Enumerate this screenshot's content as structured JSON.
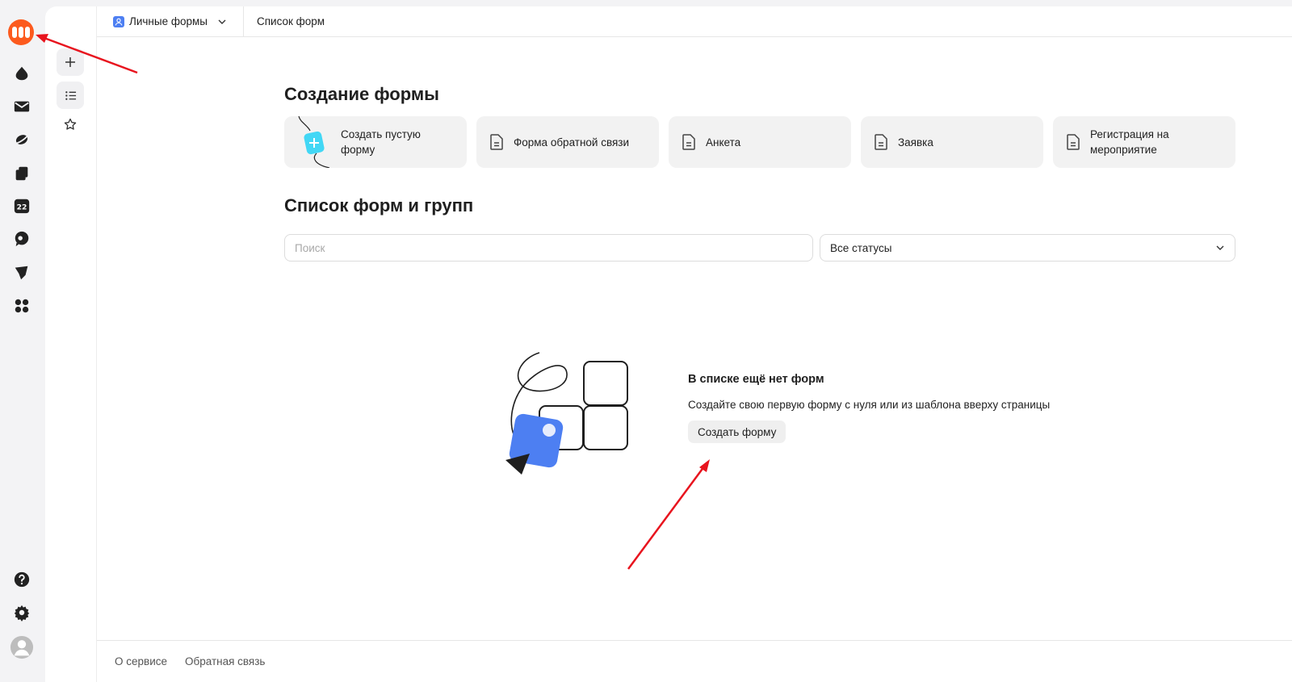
{
  "header": {
    "workspace_label": "Личные формы",
    "breadcrumb": "Список форм"
  },
  "create_section": {
    "title": "Создание формы",
    "templates": [
      {
        "label": "Создать пустую форму",
        "icon": "blank-form-illustration"
      },
      {
        "label": "Форма обратной связи",
        "icon": "document-icon"
      },
      {
        "label": "Анкета",
        "icon": "document-icon"
      },
      {
        "label": "Заявка",
        "icon": "document-icon"
      },
      {
        "label": "Регистрация на мероприятие",
        "icon": "document-icon"
      }
    ]
  },
  "list_section": {
    "title": "Список форм и групп",
    "search_placeholder": "Поиск",
    "status_select": "Все статусы"
  },
  "empty_state": {
    "title": "В списке ещё нет форм",
    "description": "Создайте свою первую форму с нуля или из шаблона вверху страницы",
    "button_label": "Создать форму"
  },
  "footer": {
    "about": "О сервисе",
    "feedback": "Обратная связь"
  },
  "colors": {
    "brand": "#fc5a1e",
    "accent_blue": "#4d7ff2",
    "annotation_arrow": "#e8141e"
  }
}
